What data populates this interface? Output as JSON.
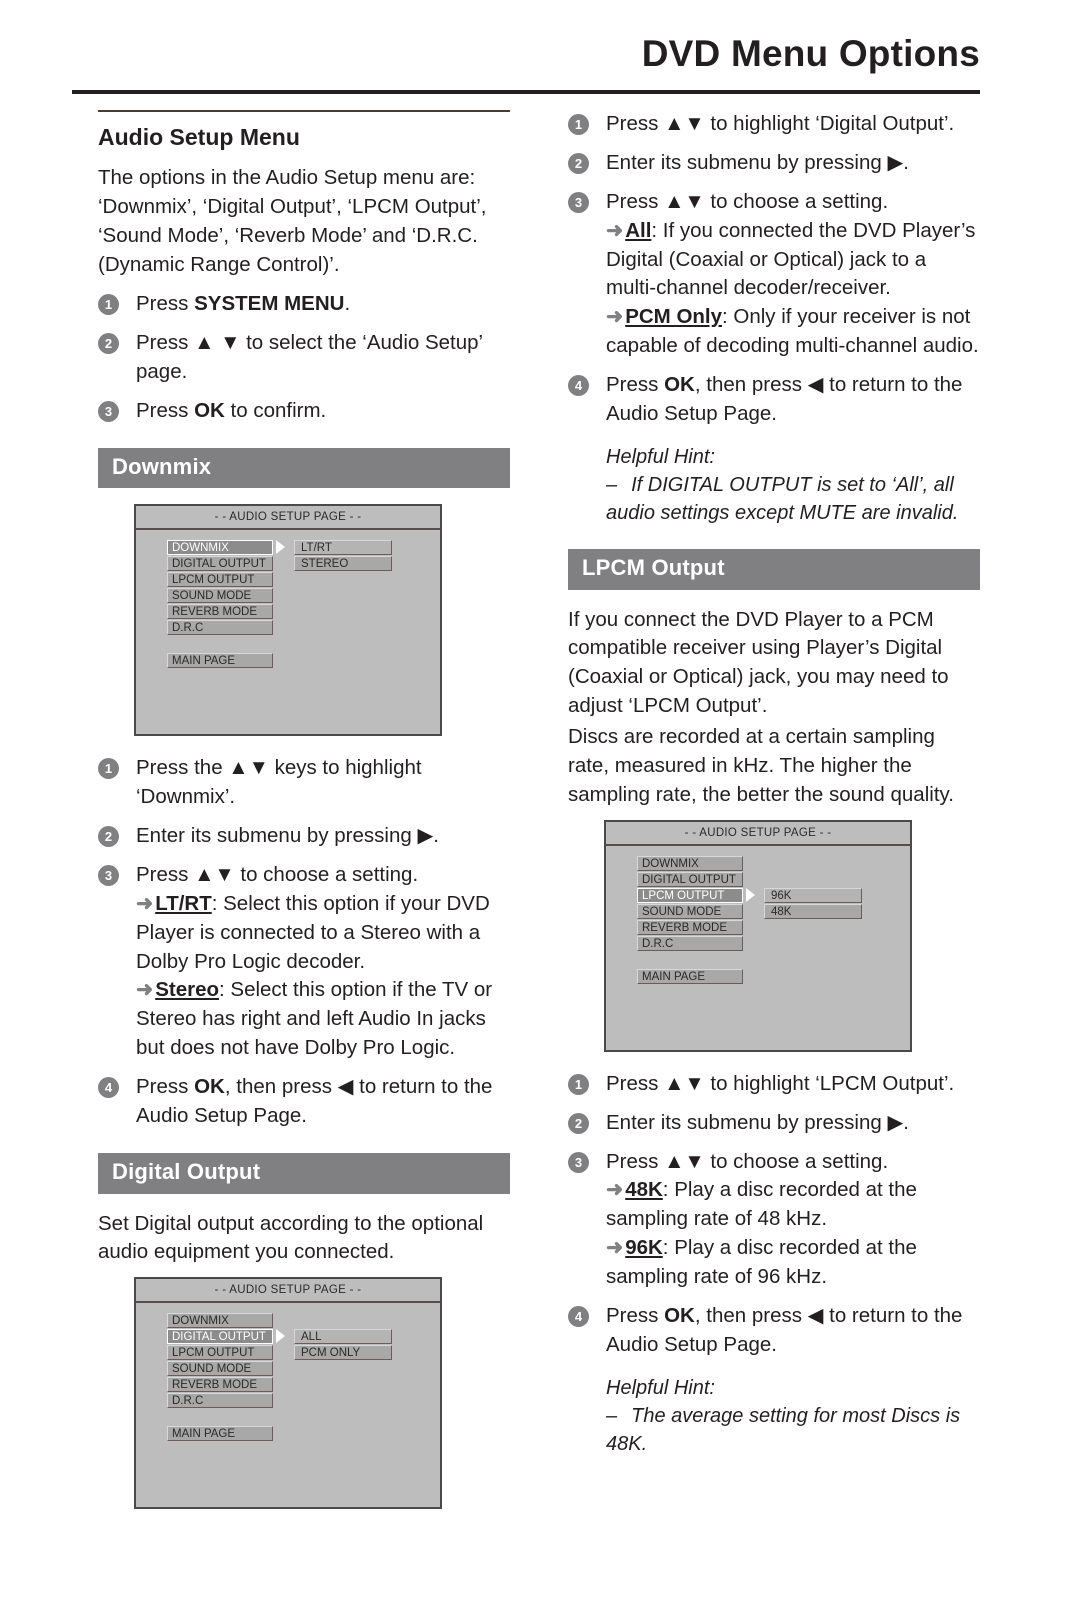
{
  "header": {
    "title": "DVD Menu Options"
  },
  "left": {
    "subhead": "Audio Setup Menu",
    "intro": "The options in the Audio Setup menu are: ‘Downmix’, ‘Digital Output’, ‘LPCM Output’, ‘Sound Mode’, ‘Reverb Mode’ and ‘D.R.C. (Dynamic Range Control)’.",
    "steps": [
      {
        "num": "1",
        "pre": "Press ",
        "bold": "SYSTEM MENU",
        "post": "."
      },
      {
        "num": "2",
        "pre": "Press ▲ ▼ to select the ‘Audio Setup’ page.",
        "bold": "",
        "post": ""
      },
      {
        "num": "3",
        "pre": "Press ",
        "bold": "OK",
        "post": " to confirm."
      }
    ],
    "downmix": {
      "bar": "Downmix",
      "screen": {
        "title": "- - AUDIO SETUP PAGE - -",
        "menu": [
          "DOWNMIX",
          "DIGITAL OUTPUT",
          "LPCM OUTPUT",
          "SOUND MODE",
          "REVERB MODE",
          "D.R.C"
        ],
        "selected_index": 0,
        "main_page": "MAIN PAGE",
        "submenu": [
          "LT/RT",
          "STEREO"
        ],
        "submenu_highlight_index": 0
      },
      "steps": {
        "s1": "Press the ▲▼ keys to highlight ‘Downmix’.",
        "s2": "Enter its submenu by pressing ▶.",
        "s3_head": "Press ▲▼ to choose a setting.",
        "s3_opt1_name": "LT/RT",
        "s3_opt1_text": ": Select this option if your DVD Player is connected to a Stereo with a Dolby Pro Logic decoder.",
        "s3_opt2_name": "Stereo",
        "s3_opt2_text": ": Select this option if the TV or Stereo has right and left Audio In jacks but does not have Dolby Pro Logic.",
        "s4_pre": "Press ",
        "s4_bold": "OK",
        "s4_post": ", then press ◀ to return to the Audio Setup Page."
      }
    },
    "digital_output": {
      "bar": "Digital Output",
      "para": "Set Digital output according to the optional audio equipment you connected.",
      "screen": {
        "title": "- - AUDIO SETUP PAGE - -",
        "menu": [
          "DOWNMIX",
          "DIGITAL OUTPUT",
          "LPCM OUTPUT",
          "SOUND MODE",
          "REVERB MODE",
          "D.R.C"
        ],
        "selected_index": 1,
        "main_page": "MAIN PAGE",
        "submenu": [
          "ALL",
          "PCM ONLY"
        ],
        "submenu_highlight_index": 0
      }
    }
  },
  "right": {
    "digital_output_steps": {
      "s1": "Press ▲▼ to highlight ‘Digital Output’.",
      "s2": "Enter its submenu by pressing ▶.",
      "s3_head": "Press ▲▼ to choose a setting.",
      "s3_opt1_name": "All",
      "s3_opt1_text": ": If you connected the DVD Player’s Digital (Coaxial or Optical) jack to a multi-channel decoder/receiver.",
      "s3_opt2_name": "PCM Only",
      "s3_opt2_text": ": Only if your receiver is not capable of decoding multi-channel audio.",
      "s4_pre": "Press ",
      "s4_bold": "OK",
      "s4_post": ", then press ◀ to return to the Audio Setup Page.",
      "hint_label": "Helpful Hint:",
      "hint_dash": "–",
      "hint_text": "If DIGITAL OUTPUT is set to ‘All’, all audio settings except MUTE are invalid."
    },
    "lpcm": {
      "bar": "LPCM Output",
      "para1": "If you connect the DVD Player to a PCM compatible receiver using Player’s Digital (Coaxial or Optical) jack, you may need to adjust ‘LPCM Output’.",
      "para2": "Discs are recorded at a certain sampling rate, measured in kHz. The higher the sampling rate, the better the sound quality.",
      "screen": {
        "title": "- - AUDIO SETUP PAGE - -",
        "menu": [
          "DOWNMIX",
          "DIGITAL OUTPUT",
          "LPCM OUTPUT",
          "SOUND MODE",
          "REVERB MODE",
          "D.R.C"
        ],
        "selected_index": 2,
        "main_page": "MAIN PAGE",
        "submenu": [
          "96K",
          "48K"
        ],
        "submenu_highlight_index": 0
      },
      "steps": {
        "s1": "Press ▲▼ to highlight ‘LPCM Output’.",
        "s2": "Enter its submenu by pressing ▶.",
        "s3_head": "Press ▲▼ to choose a setting.",
        "s3_opt1_name": "48K",
        "s3_opt1_text": ": Play a disc recorded at the sampling rate of 48 kHz.",
        "s3_opt2_name": "96K",
        "s3_opt2_text": ": Play a disc recorded at the sampling rate of 96 kHz.",
        "s4_pre": "Press ",
        "s4_bold": "OK",
        "s4_post": ", then press ◀ to return to the Audio Setup Page.",
        "hint_label": "Helpful Hint:",
        "hint_dash": "–",
        "hint_text": "The average setting for most Discs is 48K."
      }
    }
  },
  "icons": {
    "arrow_right_bullet": "➜",
    "cursor_right": "▶"
  },
  "colors": {
    "bar_gray": "#808083",
    "screen_bg": "#bdbdbd",
    "ink": "#231f20"
  }
}
